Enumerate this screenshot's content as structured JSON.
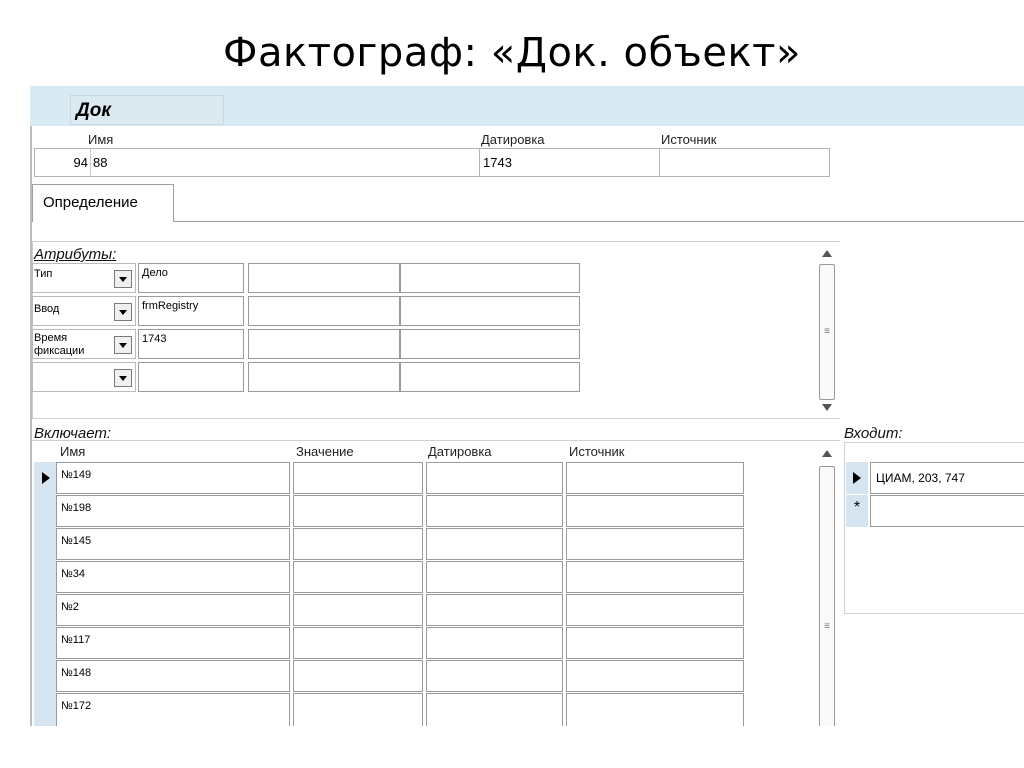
{
  "slide": {
    "title": "Фактограф: «Док. объект»"
  },
  "form": {
    "caption": "Док",
    "labels": {
      "name": "Имя",
      "date": "Датировка",
      "source": "Источник"
    },
    "fields": {
      "id": "94",
      "name": "88",
      "date": "1743",
      "source": ""
    }
  },
  "tabs": [
    {
      "label": "Определение"
    }
  ],
  "attributes": {
    "title": "Атрибуты:",
    "rows": [
      {
        "type": "Тип",
        "value": "Дело"
      },
      {
        "type": "Ввод",
        "value": "frmRegistry"
      },
      {
        "type": "Время фиксации",
        "value": "1743"
      },
      {
        "type": "",
        "value": ""
      }
    ]
  },
  "includes": {
    "title": "Включает:",
    "columns": {
      "name": "Имя",
      "value": "Значение",
      "date": "Датировка",
      "source": "Источник"
    },
    "rows": [
      {
        "name": "№149"
      },
      {
        "name": "№198"
      },
      {
        "name": "№145"
      },
      {
        "name": "№34"
      },
      {
        "name": "№2"
      },
      {
        "name": "№117"
      },
      {
        "name": "№148"
      },
      {
        "name": "№172"
      }
    ]
  },
  "enters": {
    "title": "Входит:",
    "rows": [
      {
        "name": "ЦИАМ, 203, 747"
      }
    ],
    "new_row_marker": "*"
  },
  "icons": {
    "combo": "chevron-down-icon",
    "record": "record-selector-icon",
    "scroll_up": "scroll-up-icon",
    "scroll_down": "scroll-down-icon",
    "new": "new-record-icon"
  },
  "colors": {
    "header_band": "#d9ebf2",
    "row_selector": "#d6e4f0"
  }
}
